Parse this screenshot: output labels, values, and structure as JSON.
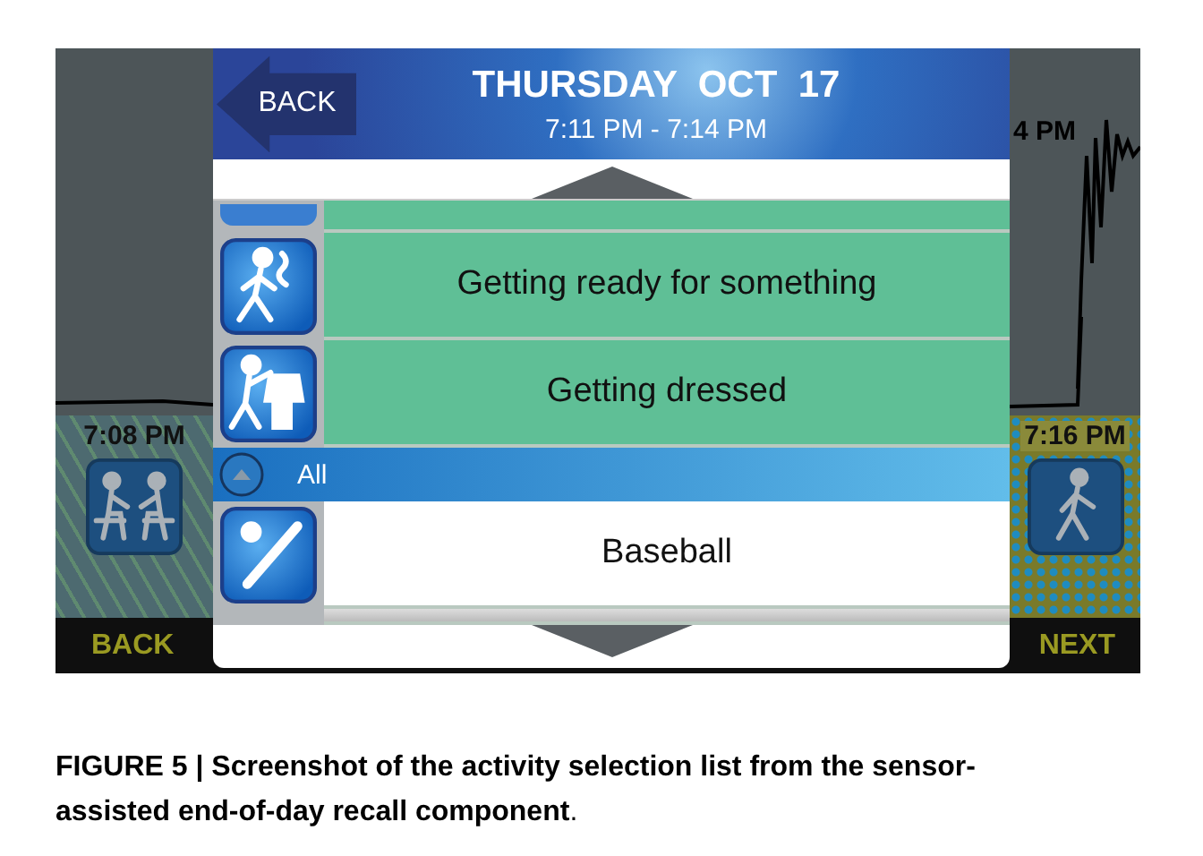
{
  "timeline": {
    "left_time": "7:08 PM",
    "top_right_time": "4 PM",
    "right_time": "7:16 PM"
  },
  "nav": {
    "back": "BACK",
    "next": "NEXT"
  },
  "dialog": {
    "back_button": "BACK",
    "title": "THURSDAY  OCT  17",
    "time_range": "7:11 PM - 7:14 PM",
    "items": [
      {
        "kind": "activity",
        "label": "Getting ready for something",
        "selected": true
      },
      {
        "kind": "activity",
        "label": "Getting dressed",
        "selected": true
      },
      {
        "kind": "category",
        "label": "All",
        "expanded": true
      },
      {
        "kind": "activity",
        "label": "Baseball",
        "selected": false
      }
    ]
  },
  "caption": "**FIGURE 5 | Screenshot of the activity selection list from the sensor-assisted end-of-day recall component**."
}
